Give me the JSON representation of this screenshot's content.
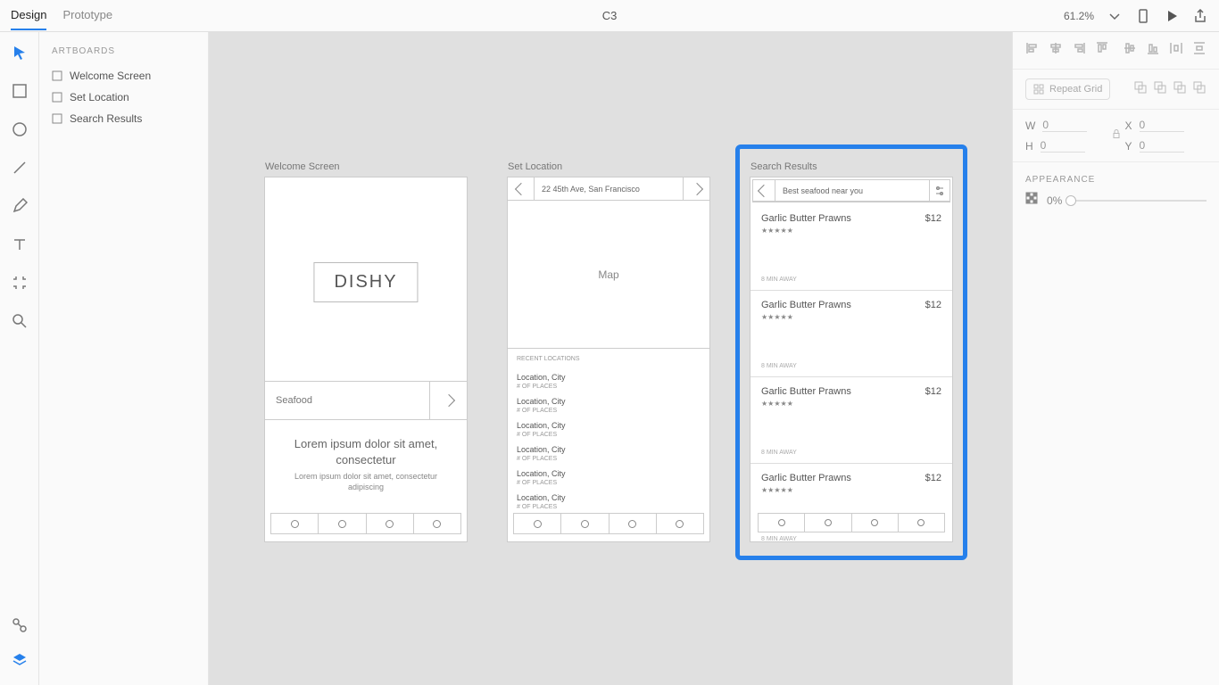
{
  "tabs": {
    "design": "Design",
    "prototype": "Prototype"
  },
  "doc_title": "C3",
  "zoom": "61.2%",
  "layers": {
    "heading": "ARTBOARDS",
    "items": [
      "Welcome Screen",
      "Set Location",
      "Search Results"
    ]
  },
  "props": {
    "repeat_label": "Repeat Grid",
    "W": "0",
    "H": "0",
    "X": "0",
    "Y": "0",
    "W_label": "W",
    "H_label": "H",
    "X_label": "X",
    "Y_label": "Y",
    "appearance": "APPEARANCE",
    "opacity": "0%"
  },
  "artboards": {
    "welcome": {
      "label": "Welcome Screen",
      "logo": "DISHY",
      "search_placeholder": "Seafood",
      "desc1": "Lorem ipsum dolor sit amet, consectetur",
      "desc2": "Lorem ipsum dolor sit amet, consectetur adipiscing"
    },
    "location": {
      "label": "Set Location",
      "address": "22 45th Ave, San Francisco",
      "map": "Map",
      "recent": "RECENT LOCATIONS",
      "items": [
        {
          "name": "Location, City",
          "sub": "# OF PLACES"
        },
        {
          "name": "Location, City",
          "sub": "# OF PLACES"
        },
        {
          "name": "Location, City",
          "sub": "# OF PLACES"
        },
        {
          "name": "Location, City",
          "sub": "# OF PLACES"
        },
        {
          "name": "Location, City",
          "sub": "# OF PLACES"
        },
        {
          "name": "Location, City",
          "sub": "# OF PLACES"
        }
      ]
    },
    "results": {
      "label": "Search Results",
      "query": "Best seafood near you",
      "items": [
        {
          "name": "Garlic Butter Prawns",
          "price": "$12",
          "stars": "★★★★★",
          "dist": "8 MIN AWAY"
        },
        {
          "name": "Garlic Butter Prawns",
          "price": "$12",
          "stars": "★★★★★",
          "dist": "8 MIN AWAY"
        },
        {
          "name": "Garlic Butter Prawns",
          "price": "$12",
          "stars": "★★★★★",
          "dist": "8 MIN AWAY"
        },
        {
          "name": "Garlic Butter Prawns",
          "price": "$12",
          "stars": "★★★★★",
          "dist": "8 MIN AWAY"
        }
      ]
    }
  }
}
